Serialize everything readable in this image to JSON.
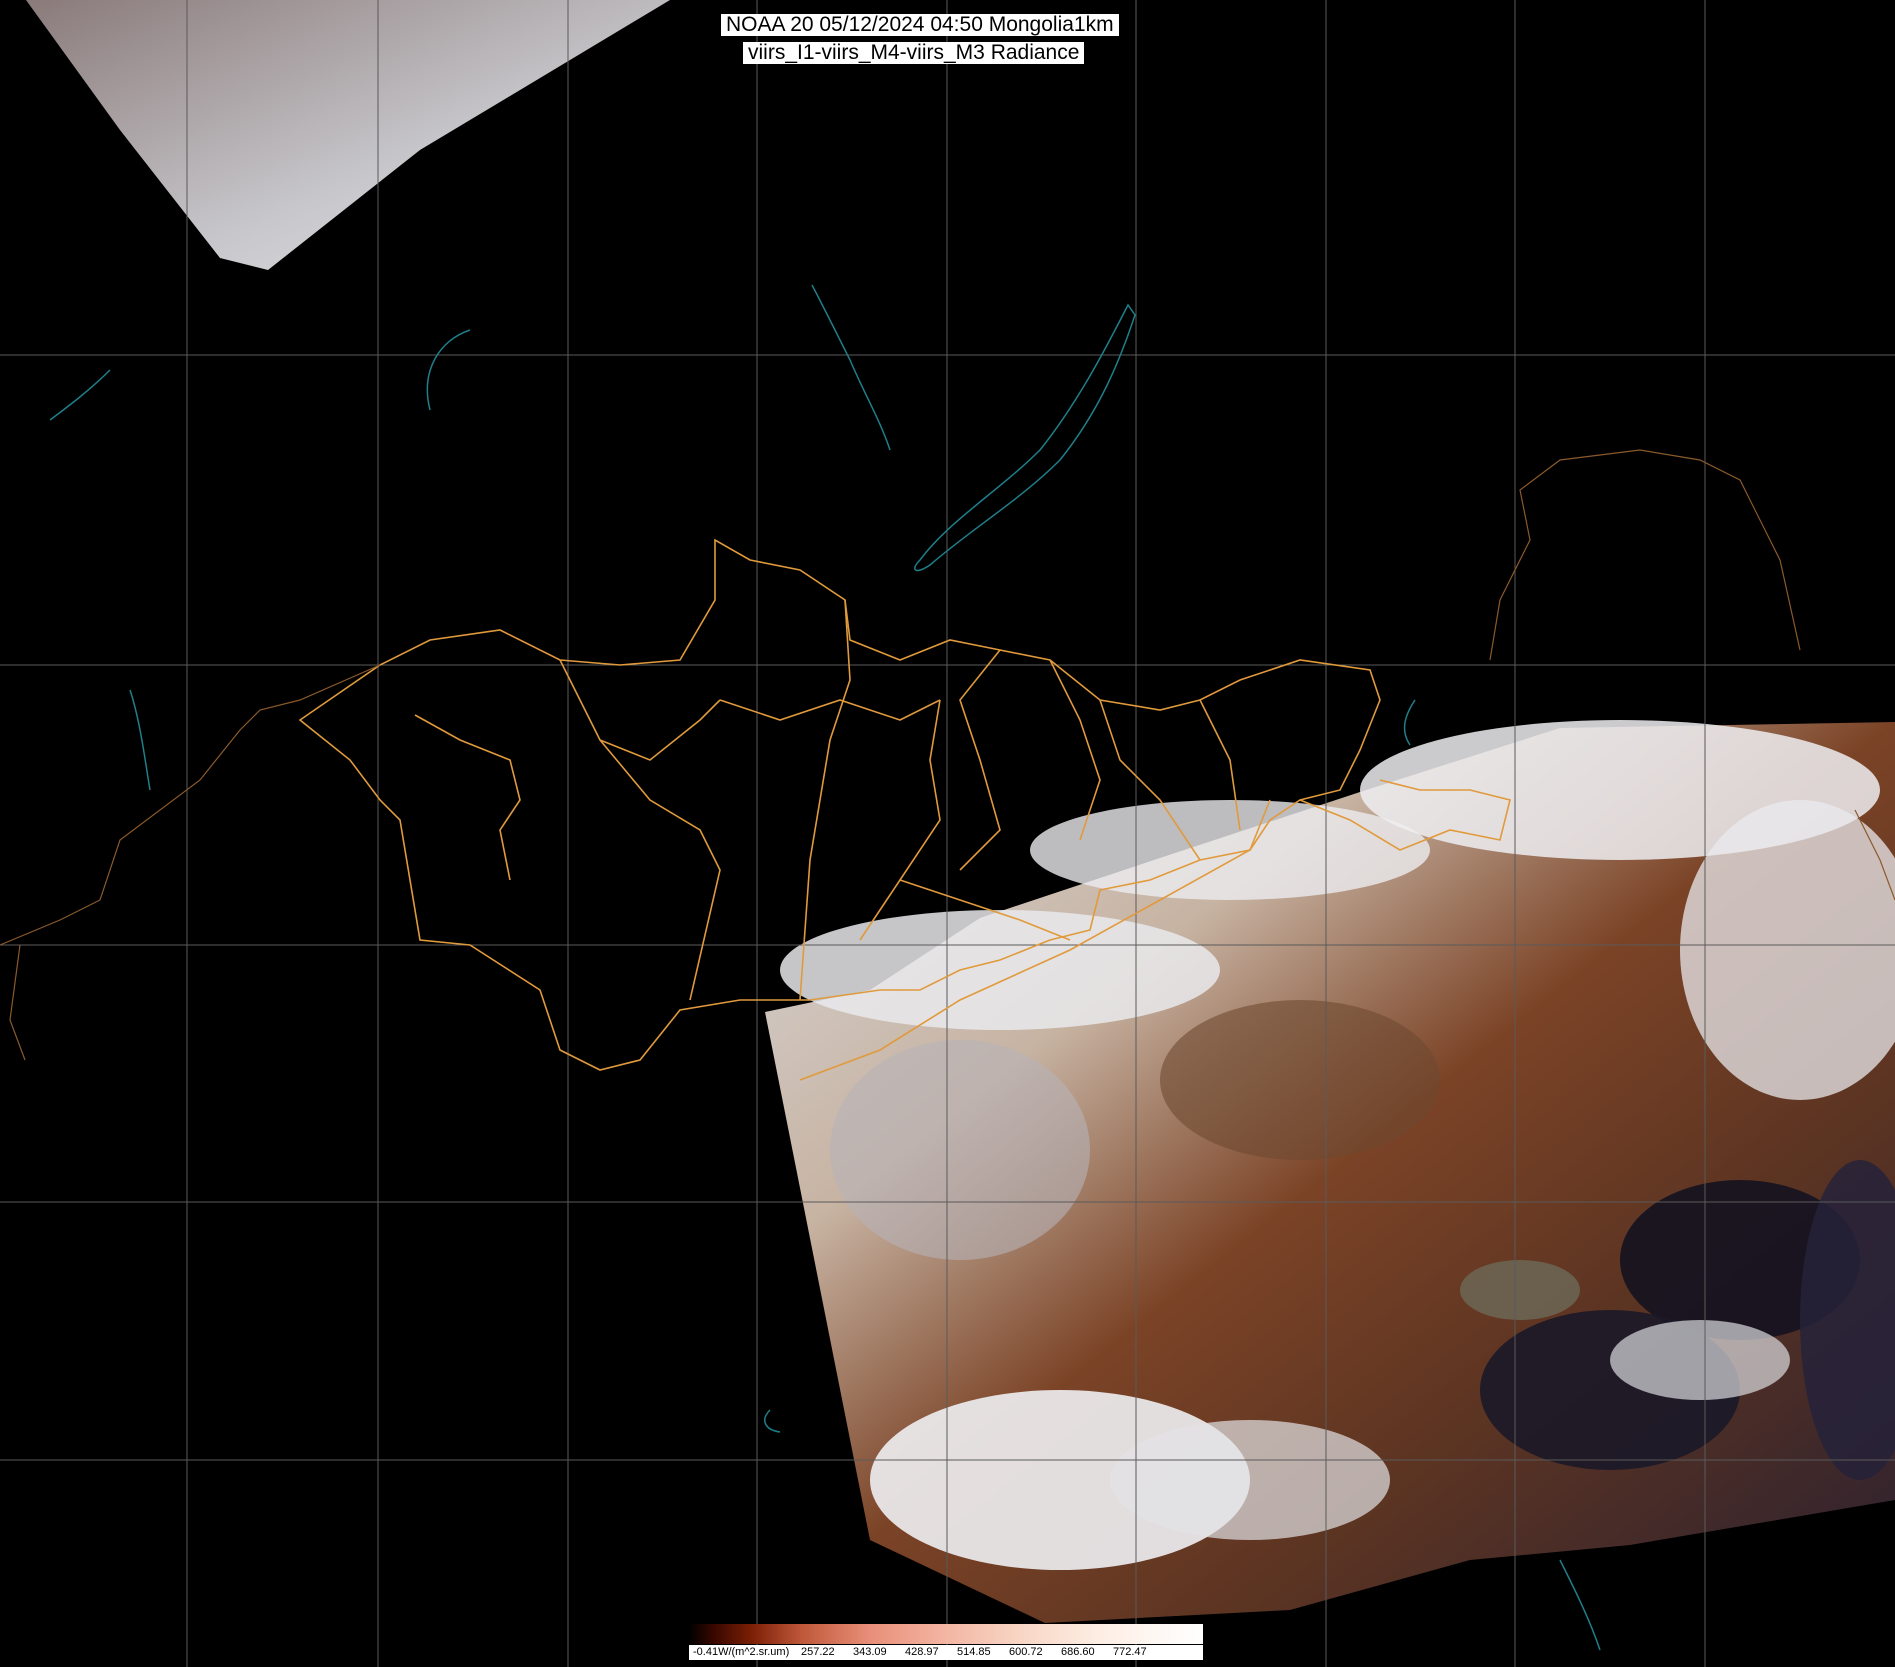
{
  "title": {
    "line1": "NOAA 20 05/12/2024 04:50 Mongolia1km",
    "line2": "viirs_I1-viirs_M4-viirs_M3 Radiance"
  },
  "colorbar": {
    "labels": [
      "-0.41W/(m^2.sr.um)",
      "257.22",
      "343.09",
      "428.97",
      "514.85",
      "600.72",
      "686.60",
      "772.47"
    ]
  },
  "colors": {
    "background": "#000000",
    "graticule": "#5a5a5a",
    "admin_border": "#e09a3c",
    "water": "#1f7f8a",
    "snow_cloud": "#e8e8ec",
    "land_brown": "#7a3a1c"
  }
}
